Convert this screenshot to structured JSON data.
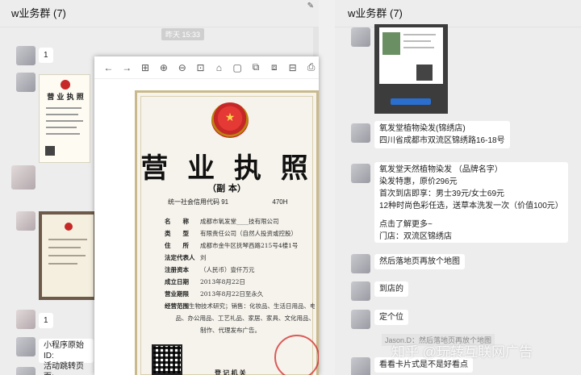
{
  "left_chat": {
    "title": "w业务群 (7)",
    "timestamp": "昨天 15:33",
    "messages": [
      {
        "text": "1"
      },
      {
        "text": "1"
      },
      {
        "text": "小程序原始ID:"
      },
      {
        "text": "活动跳转页面:"
      }
    ],
    "thumb_license_title": "营 业 执 照"
  },
  "viewer": {
    "toolbar": [
      "←",
      "→",
      "⊞",
      "⊕",
      "⊖",
      "⊡",
      "⌂",
      "▢",
      "⧉",
      "⧈",
      "⊟",
      "⎙"
    ],
    "certificate": {
      "title": "营 业 执 照",
      "subtitle": "（副  本）",
      "credit_code_label": "统一社会信用代码",
      "credit_code_value": "91",
      "credit_code_tail": "470H",
      "fields": [
        {
          "k": "名　　称",
          "v": "成都市氧发堂____技有限公司"
        },
        {
          "k": "类　　型",
          "v": "有限责任公司（自然人投资或控股）"
        },
        {
          "k": "住　　所",
          "v": "成都市金牛区抚琴西路215号4楼1号"
        },
        {
          "k": "法定代表人",
          "v": "刘"
        },
        {
          "k": "注册资本",
          "v": "（人民币）壹仟万元"
        },
        {
          "k": "成立日期",
          "v": "2013年8月22日"
        },
        {
          "k": "营业期限",
          "v": "2013年8月22日至永久"
        },
        {
          "k": "经营范围",
          "v": "生物技术研究；销售：化妆品、生活日用品、电子产"
        },
        {
          "k": "",
          "v": "品、办公用品、工艺礼品、家居、家具、文化用品、"
        },
        {
          "k": "",
          "v": "制作、代理发布广告。"
        }
      ],
      "issuer": "登 记 机 关"
    }
  },
  "right_chat": {
    "title": "w业务群 (7)",
    "messages": [
      {
        "lines": [
          "氧发堂植物染发(锦绣店)",
          "四川省成都市双流区锦绣路16-18号"
        ]
      },
      {
        "lines": [
          "氧发堂天然植物染发 （品牌名字）",
          "染发特惠，原价296元",
          "首次到店即享：男士39元/女士69元",
          "12种时尚色彩任选，送草本洗发一次（价值100元）",
          "",
          "点击了解更多~",
          "门店：双流区锦绣店"
        ]
      },
      {
        "lines": [
          "然后落地页再放个地图"
        ]
      },
      {
        "lines": [
          "到店的"
        ]
      },
      {
        "lines": [
          "定个位"
        ]
      },
      {
        "lines": [
          "看看卡片式是不是好看点"
        ]
      }
    ],
    "ghost_reply": "Jason.D：然后落地页再放个地图",
    "watermark": "知乎 @玩转互联网广告"
  },
  "colors": {
    "window_bg": "#ededed",
    "bubble": "#ffffff",
    "emblem_red": "#c62828",
    "frame_gold": "#c9b98b"
  }
}
